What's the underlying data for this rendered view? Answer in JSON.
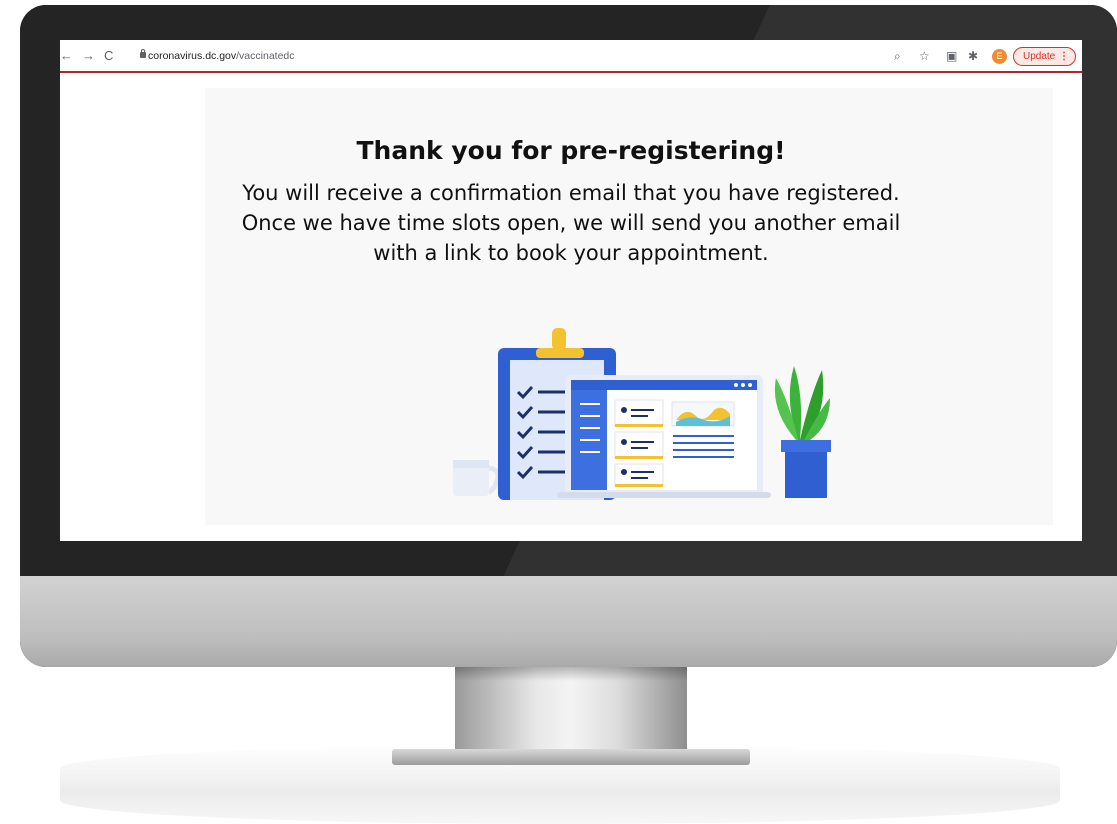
{
  "browser": {
    "url_host": "coronavirus.dc.gov",
    "url_path": "/vaccinatedc",
    "avatar_letter": "E",
    "update_label": "Update",
    "menu_glyph": "⋮",
    "icons": [
      "back-arrow-icon",
      "forward-arrow-icon",
      "reload-icon",
      "lock-icon",
      "zoom-icon",
      "star-icon",
      "reading-list-icon",
      "extensions-icon"
    ],
    "colors": {
      "accent": "#b3242e",
      "update": "#d93025",
      "avatar": "#f28b2e"
    }
  },
  "page": {
    "heading": "Thank you for pre-registering!",
    "message": "You will receive a confirmation email that you have registered. Once we have time slots open, we will send you another email with a link to book your appointment."
  },
  "illustration": {
    "elements": [
      "clipboard-checklist",
      "laptop-dashboard",
      "plant-pot",
      "coffee-cup"
    ],
    "colors": {
      "blue": "#2f5fd0",
      "yellow": "#f2c230",
      "green": "#3db23a",
      "navy": "#1c2f6b"
    }
  }
}
